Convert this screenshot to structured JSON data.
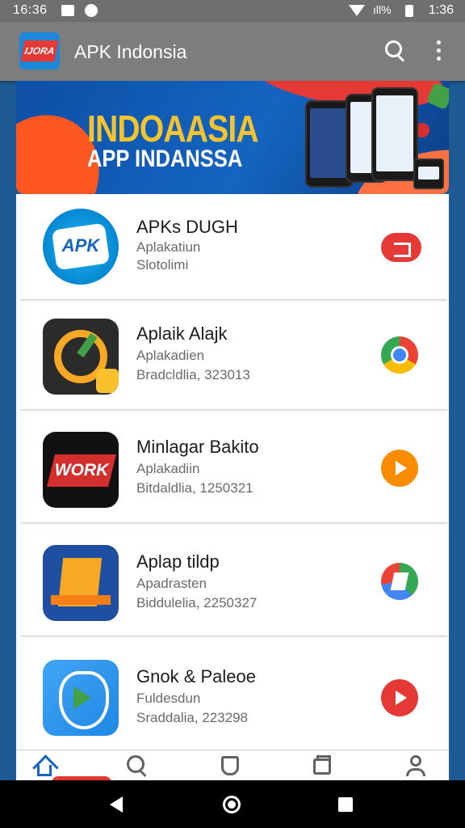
{
  "status_bar": {
    "time_left": "16:36",
    "signal_text": "ıll%",
    "time_right": "1:36"
  },
  "app_bar": {
    "logo_text": "IJORA",
    "title": "APK Indonsia"
  },
  "banner": {
    "title": "INDOAASIA",
    "subtitle": "APP INDANSSA"
  },
  "apps": [
    {
      "name": "APKs DUGH",
      "line1": "Aplakatiun",
      "line2": "Slotolimi",
      "icon": "apk-icon",
      "icon_text": "APK",
      "action_icon": "red-pill-icon"
    },
    {
      "name": "Aplaik Alajk",
      "line1": "Aplakadien",
      "line2": "Bradcldlia, 323013",
      "icon": "q-check-icon",
      "action_icon": "chrome-icon"
    },
    {
      "name": "Minlagar Bakito",
      "line1": "Aplakadiin",
      "line2": "Bitdaldlia, 1250321",
      "icon": "work-icon",
      "icon_text": "WORK",
      "action_icon": "play-orange-icon"
    },
    {
      "name": "Aplap tildp",
      "line1": "Apadrasten",
      "line2": "Biddulelia, 2250327",
      "icon": "build-icon",
      "action_icon": "maps-icon"
    },
    {
      "name": "Gnok & Paleoe",
      "line1": "Fuldesdun",
      "line2": "Sraddalia, 223298",
      "icon": "play-shield-icon",
      "action_icon": "play-red-icon"
    }
  ],
  "colors": {
    "accent": "#1565c0",
    "app_bar": "#7d7d7d",
    "status_bar": "#6f6f6f",
    "banner_title": "#f4c430"
  }
}
